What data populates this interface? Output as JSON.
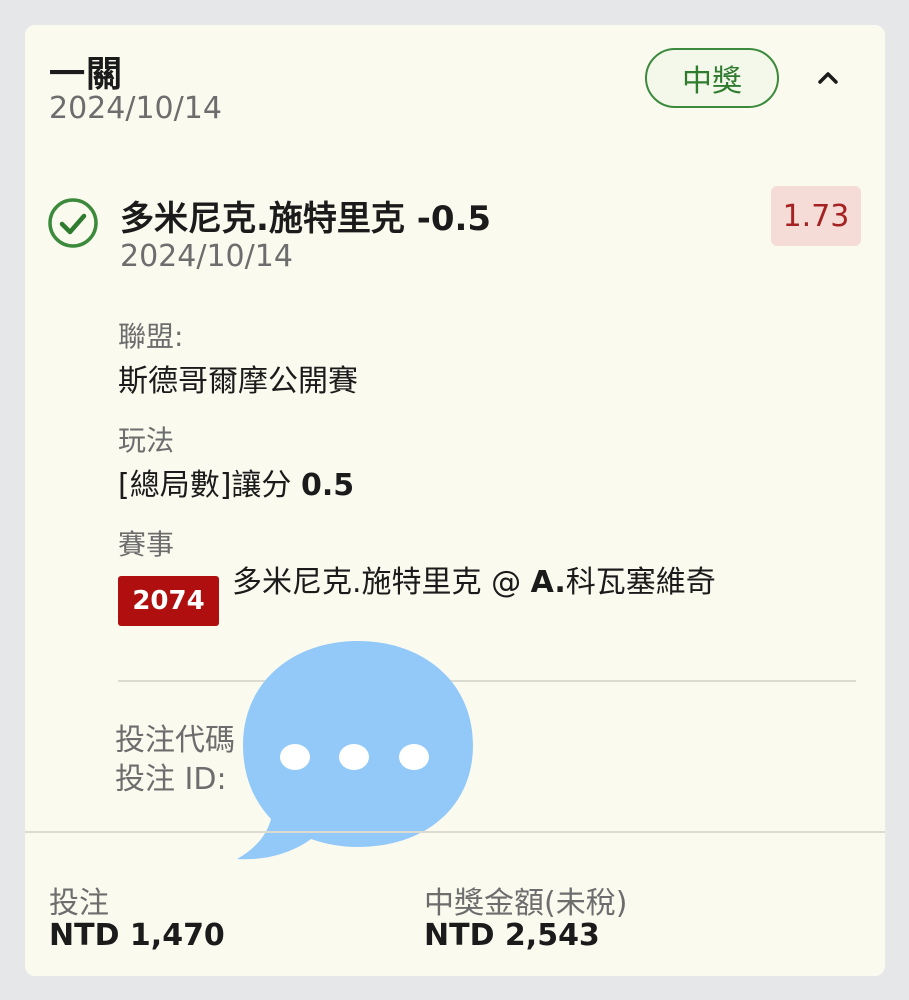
{
  "bet": {
    "type_title": "一關",
    "date": "2024/10/14",
    "status_badge": "中獎",
    "colors": {
      "win_green": "#3c8a3c",
      "odds_red": "#a42222",
      "event_tag_red": "#b00f0f",
      "card_bg": "#fbfaef"
    },
    "icons": {
      "collapse": "chevron-up-icon",
      "status": "check-circle-icon",
      "overlay": "chat-bubble-icon"
    }
  },
  "selection": {
    "title": "多米尼克.施特里克 -0.5",
    "date": "2024/10/14",
    "odds": "1.73",
    "league_label": "聯盟:",
    "league_value": "斯德哥爾摩公開賽",
    "market_label": "玩法",
    "market_prefix": "[總局數]讓分 ",
    "market_line": "0.5",
    "event_label": "賽事",
    "event_id": "2074",
    "event_home": "多米尼克.施特里克 @ ",
    "event_away_bold": "A.",
    "event_away_rest": "科瓦塞維奇"
  },
  "codes": {
    "bet_code_label": "投注代碼",
    "bet_id_label": "投注 ID:"
  },
  "summary": {
    "stake_label": "投注",
    "stake_value": "NTD 1,470",
    "payout_label": "中獎金額(未稅)",
    "payout_value": "NTD 2,543"
  }
}
